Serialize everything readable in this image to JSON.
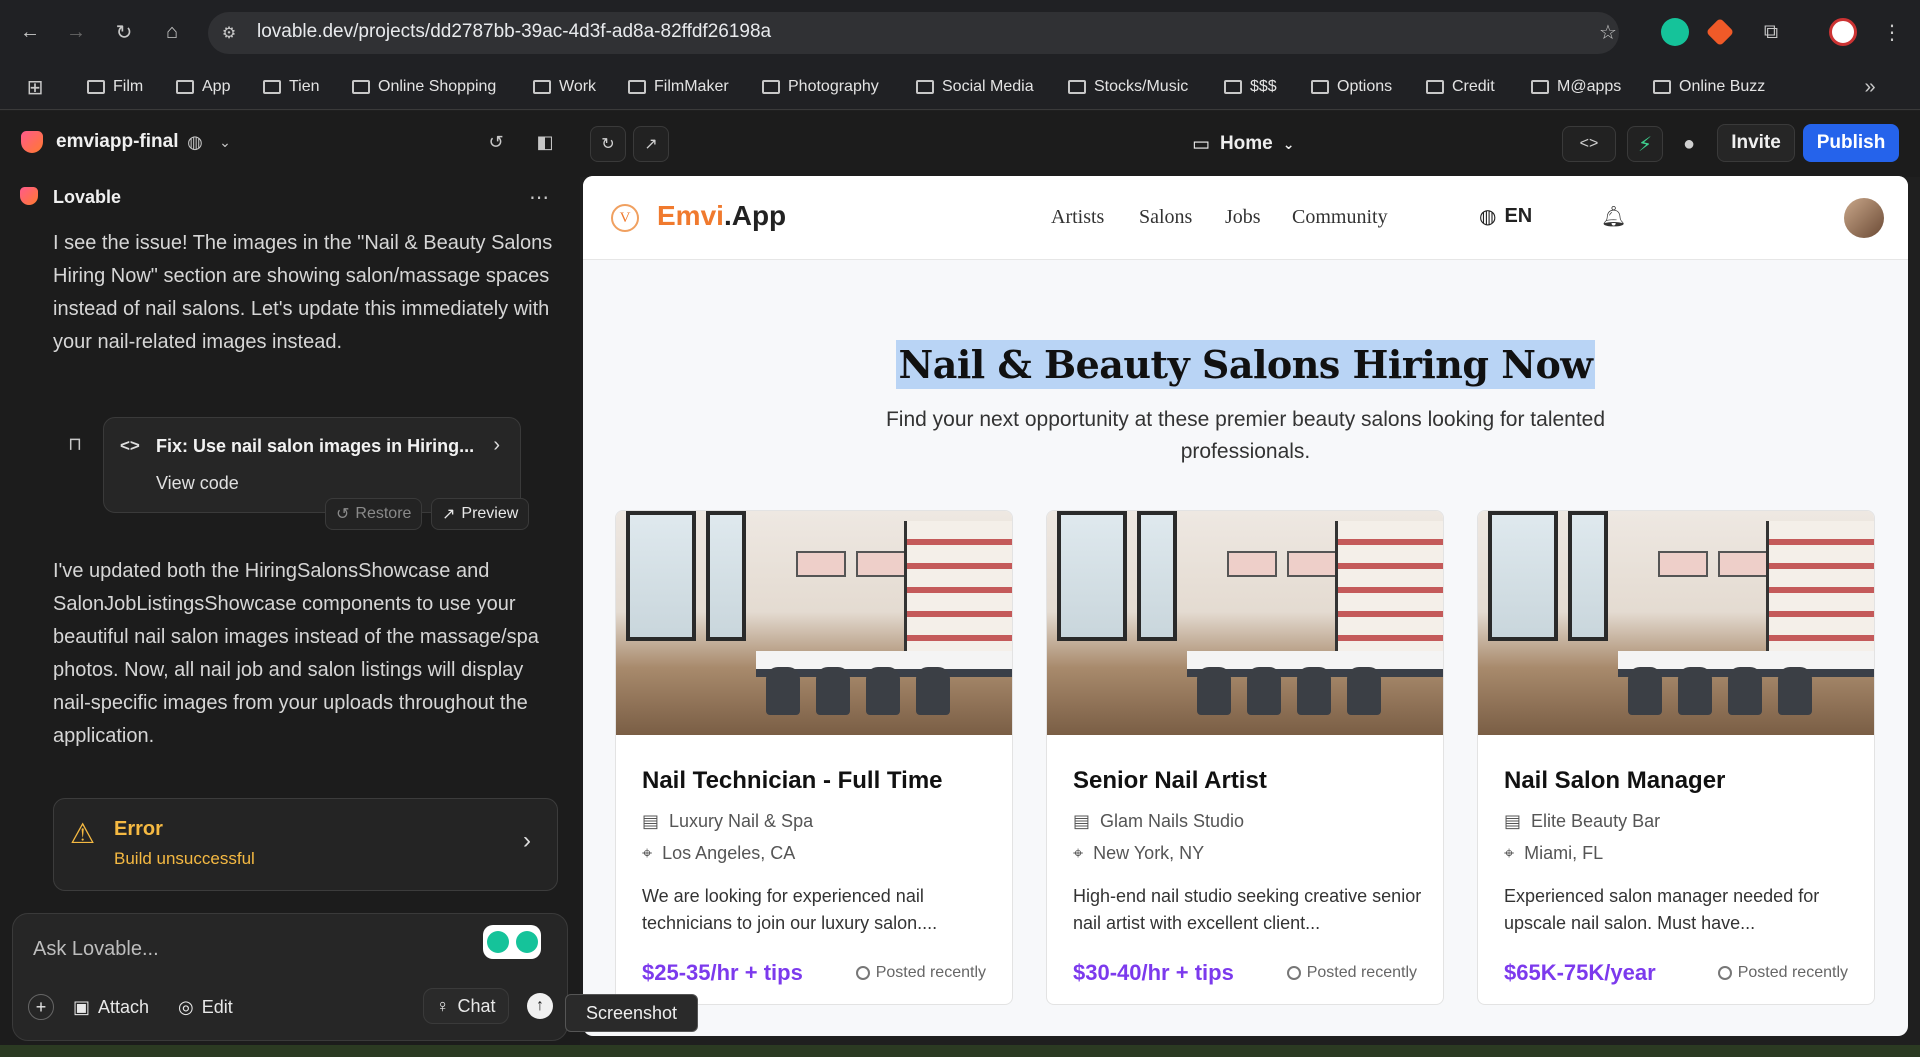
{
  "browser": {
    "url": "lovable.dev/projects/dd2787bb-39ac-4d3f-ad8a-82ffdf26198a",
    "bookmarks": [
      "Film",
      "App",
      "Tien",
      "Online Shopping",
      "Work",
      "FilmMaker",
      "Photography",
      "Social Media",
      "Stocks/Music",
      "$$$",
      "Options",
      "Credit",
      "M@apps",
      "Online Buzz"
    ]
  },
  "sidebar": {
    "project_name": "emviapp-final",
    "assistant_name": "Lovable",
    "message_1": "I see the issue! The images in the \"Nail & Beauty Salons Hiring Now\" section are showing salon/massage spaces instead of nail salons. Let's update this immediately with your nail-related images instead.",
    "fix_card": {
      "title": "Fix: Use nail salon images in Hiring...",
      "view_code": "View code",
      "restore": "Restore",
      "preview": "Preview"
    },
    "message_2": "I've updated both the HiringSalonsShowcase and SalonJobListingsShowcase components to use your beautiful nail salon images instead of the massage/spa photos. Now, all nail job and salon listings will display nail-specific images from your uploads throughout the application.",
    "error": {
      "title": "Error",
      "subtitle": "Build unsuccessful"
    },
    "input_placeholder": "Ask Lovable...",
    "tools": {
      "attach": "Attach",
      "edit": "Edit",
      "chat": "Chat"
    }
  },
  "toolbar": {
    "page_selector": "Home",
    "invite": "Invite",
    "publish": "Publish"
  },
  "site": {
    "brand_first": "Emvi",
    "brand_second": ".App",
    "nav": [
      "Artists",
      "Salons",
      "Jobs",
      "Community"
    ],
    "language": "EN",
    "hero_title": "Nail & Beauty Salons Hiring Now",
    "hero_subtitle": "Find your next opportunity at these premier beauty salons looking for talented professionals.",
    "jobs": [
      {
        "title": "Nail Technician - Full Time",
        "salon": "Luxury Nail & Spa",
        "location": "Los Angeles, CA",
        "description": "We are looking for experienced nail technicians to join our luxury salon....",
        "pay": "$25-35/hr + tips",
        "posted": "Posted recently"
      },
      {
        "title": "Senior Nail Artist",
        "salon": "Glam Nails Studio",
        "location": "New York, NY",
        "description": "High-end nail studio seeking creative senior nail artist with excellent client...",
        "pay": "$30-40/hr + tips",
        "posted": "Posted recently"
      },
      {
        "title": "Nail Salon Manager",
        "salon": "Elite Beauty Bar",
        "location": "Miami, FL",
        "description": "Experienced salon manager needed for upscale nail salon. Must have...",
        "pay": "$65K-75K/year",
        "posted": "Posted recently"
      }
    ]
  },
  "tooltip": "Screenshot",
  "colors": {
    "publish": "#2563eb",
    "brand_orange": "#f07a2e",
    "pay_purple": "#7c3aed",
    "error_amber": "#f5b942",
    "highlight": "#b9d4f5"
  }
}
